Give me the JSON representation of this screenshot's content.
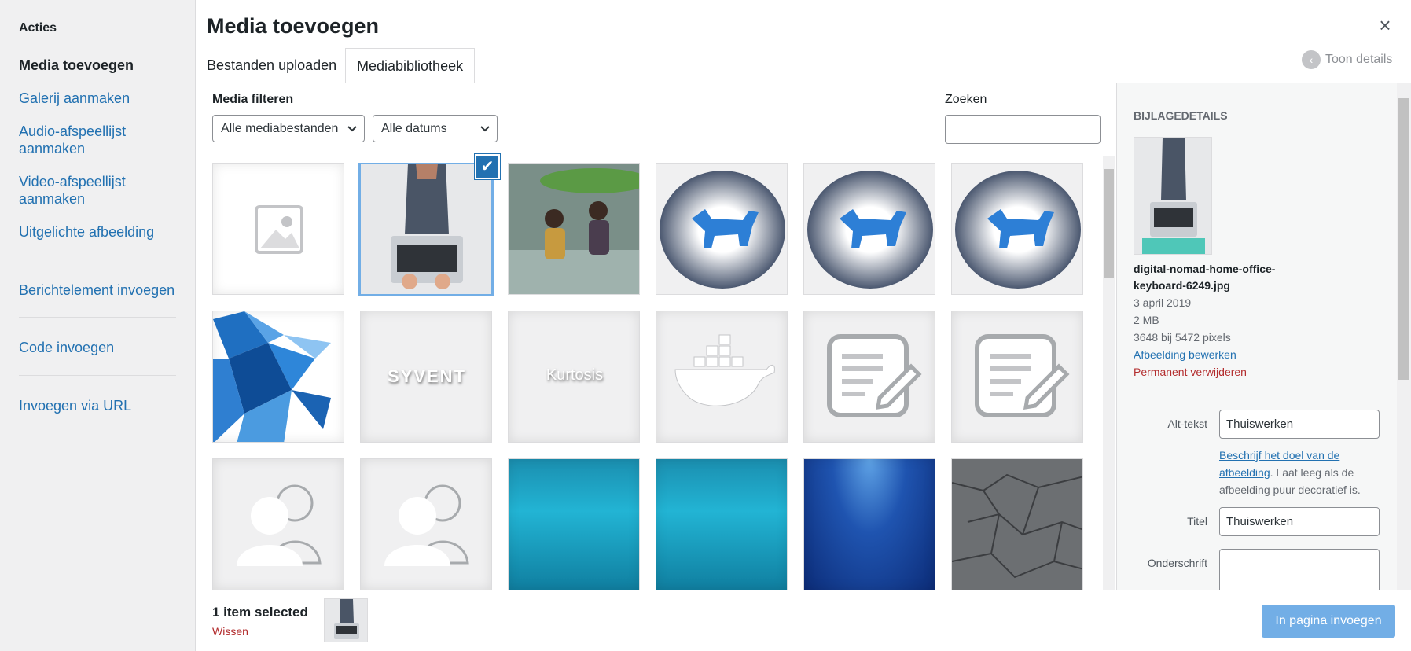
{
  "menu": {
    "heading": "Acties",
    "items": [
      {
        "label": "Media toevoegen"
      },
      {
        "label": "Galerij aanmaken"
      },
      {
        "label": "Audio-afspeellijst aanmaken"
      },
      {
        "label": "Video-afspeellijst aanmaken"
      },
      {
        "label": "Uitgelichte afbeelding"
      },
      {
        "label": "Berichtelement invoegen"
      },
      {
        "label": "Code invoegen"
      },
      {
        "label": "Invoegen via URL"
      }
    ]
  },
  "header": {
    "title": "Media toevoegen",
    "close_icon": "×",
    "tabs": [
      {
        "label": "Bestanden uploaden"
      },
      {
        "label": "Mediabibliotheek"
      }
    ],
    "toggle_details": "Toon details",
    "toggle_icon": "‹"
  },
  "toolbar": {
    "filter_label": "Media filteren",
    "type_select": "Alle mediabestanden",
    "date_select": "Alle datums",
    "search_label": "Zoeken",
    "search_value": ""
  },
  "grid": {
    "check_icon": "✔",
    "items": [
      {
        "icon": "image-placeholder-icon"
      },
      {
        "icon": "laptop-photo",
        "selected": true
      },
      {
        "icon": "girls-leaf-photo"
      },
      {
        "icon": "blue-goat-vignette"
      },
      {
        "icon": "blue-goat-vignette"
      },
      {
        "icon": "blue-goat-vignette"
      },
      {
        "icon": "polygon-goat"
      },
      {
        "icon": "syvent-logo",
        "text": "SYVENT"
      },
      {
        "icon": "kurtosis-logo",
        "text": "Kurtosis"
      },
      {
        "icon": "docker-whale-icon"
      },
      {
        "icon": "edit-note-icon"
      },
      {
        "icon": "edit-note-icon"
      },
      {
        "icon": "users-icon"
      },
      {
        "icon": "users-icon"
      },
      {
        "icon": "underwater-cyan"
      },
      {
        "icon": "underwater-cyan"
      },
      {
        "icon": "underwater-deep"
      },
      {
        "icon": "cracked-earth"
      }
    ]
  },
  "details": {
    "heading": "Bijlagedetails",
    "filename": "digital-nomad-home-office-keyboard-6249.jpg",
    "date": "3 april 2019",
    "size": "2 MB",
    "dimensions": "3648 bij 5472 pixels",
    "edit_link": "Afbeelding bewerken",
    "delete_link": "Permanent verwijderen",
    "alt_label": "Alt-tekst",
    "alt_value": "Thuiswerken",
    "hint_link": "Beschrijf het doel van de afbeelding",
    "hint_text": ". Laat leeg als de afbeelding puur decoratief is.",
    "title_label": "Titel",
    "title_value": "Thuiswerken",
    "caption_label": "Onderschrift",
    "caption_value": ""
  },
  "bottom": {
    "selected_count": "1 item selected",
    "clear_link": "Wissen",
    "insert_button": "In pagina invoegen"
  },
  "colors": {
    "accent": "#2271b1",
    "delete": "#b32d2e",
    "button_disabled": "#72aee6"
  }
}
